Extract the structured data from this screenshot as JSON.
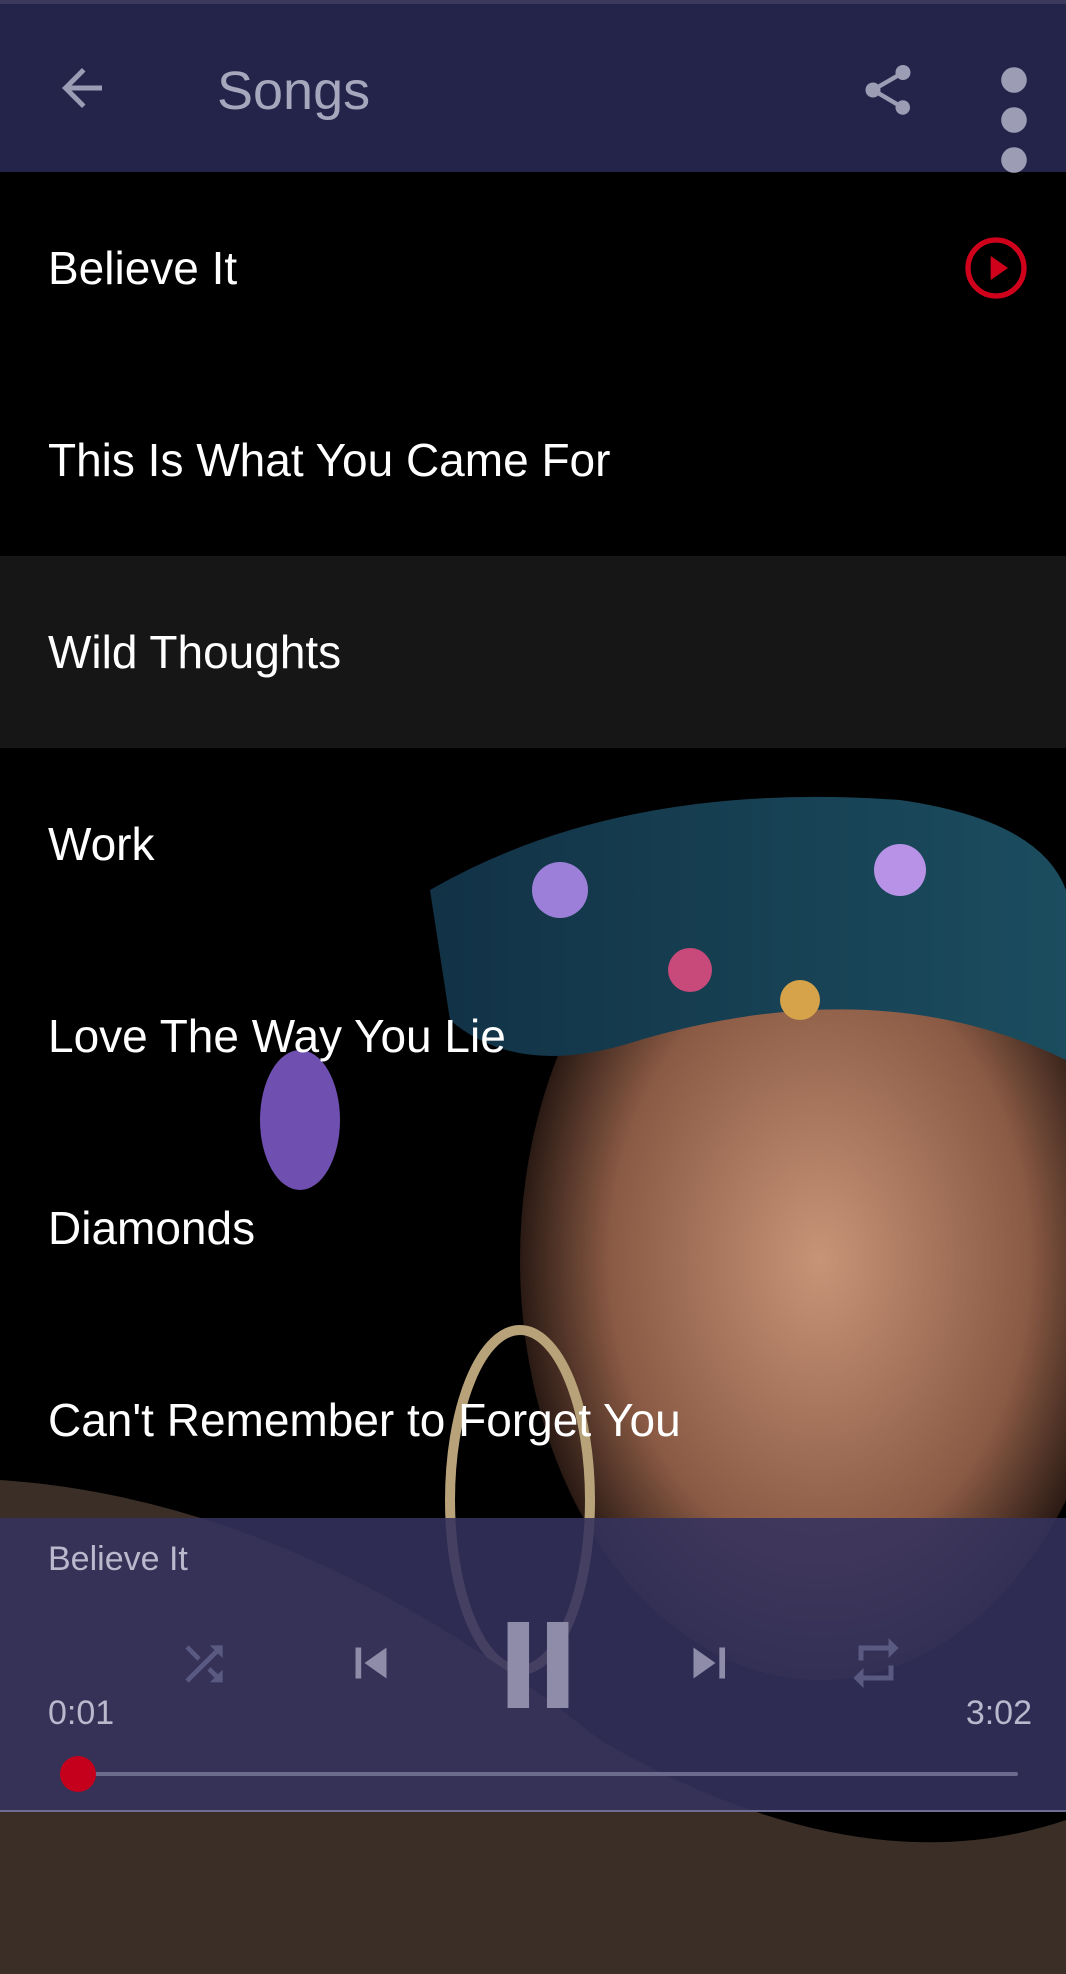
{
  "app_bar": {
    "title": "Songs"
  },
  "icons": {
    "back": "arrow-left-icon",
    "share": "share-icon",
    "more": "more-vert-icon",
    "play": "play-circle-icon",
    "shuffle": "shuffle-icon",
    "previous": "skip-previous-icon",
    "pause": "pause-icon",
    "next": "skip-next-icon",
    "repeat": "repeat-icon"
  },
  "songs": [
    {
      "title": "Believe It"
    },
    {
      "title": "This Is What You Came For"
    },
    {
      "title": "Wild Thoughts"
    },
    {
      "title": "Work"
    },
    {
      "title": "Love The Way You Lie"
    },
    {
      "title": "Diamonds"
    },
    {
      "title": "Can't Remember to Forget You"
    }
  ],
  "player": {
    "now_playing": "Believe It",
    "current_time": "0:01",
    "total_time": "3:02",
    "progress": 0.006
  },
  "colors": {
    "app_bar": "#24234a",
    "player_panel": "#34325f",
    "accent_red": "#d0021b",
    "text_primary": "#ffffff",
    "text_muted": "#b9b8cc"
  }
}
